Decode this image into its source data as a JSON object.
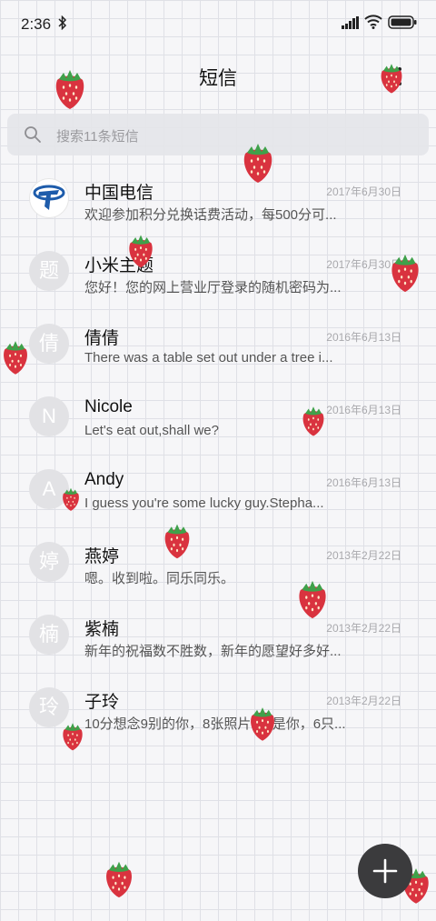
{
  "status": {
    "time": "2:36"
  },
  "header": {
    "title": "短信"
  },
  "search": {
    "placeholder": "搜索11条短信"
  },
  "messages": [
    {
      "name": "中国电信",
      "date": "2017年6月30日",
      "preview": "欢迎参加积分兑换话费活动，每500分可...",
      "avatar": ""
    },
    {
      "name": "小米主题",
      "date": "2017年6月30日",
      "preview": "您好！您的网上营业厅登录的随机密码为...",
      "avatar": "题"
    },
    {
      "name": "倩倩",
      "date": "2016年6月13日",
      "preview": "There was a table set out under a tree i...",
      "avatar": "倩"
    },
    {
      "name": "Nicole",
      "date": "2016年6月13日",
      "preview": "Let's eat out,shall we?",
      "avatar": "N"
    },
    {
      "name": "Andy",
      "date": "2016年6月13日",
      "preview": "I guess you're some lucky guy.Stepha...",
      "avatar": "A"
    },
    {
      "name": "燕婷",
      "date": "2013年2月22日",
      "preview": "嗯。收到啦。同乐同乐。",
      "avatar": "婷"
    },
    {
      "name": "紫楠",
      "date": "2013年2月22日",
      "preview": "新年的祝福数不胜数，新年的愿望好多好...",
      "avatar": "楠"
    },
    {
      "name": "子玲",
      "date": "2013年2月22日",
      "preview": "10分想念9别的你，8张照片7张是你，6只...",
      "avatar": "玲"
    }
  ],
  "icons": {
    "bluetooth": "bluetooth-icon",
    "signal": "signal-icon",
    "wifi": "wifi-icon",
    "battery": "battery-icon",
    "search": "search-icon",
    "more": "more-icon",
    "compose": "plus-icon",
    "decor": "strawberry-icon"
  },
  "colors": {
    "fab": "#3b3b3d",
    "strawberry": "#d9333f",
    "leaf": "#3fa14a",
    "telecom": "#1e5cab"
  }
}
